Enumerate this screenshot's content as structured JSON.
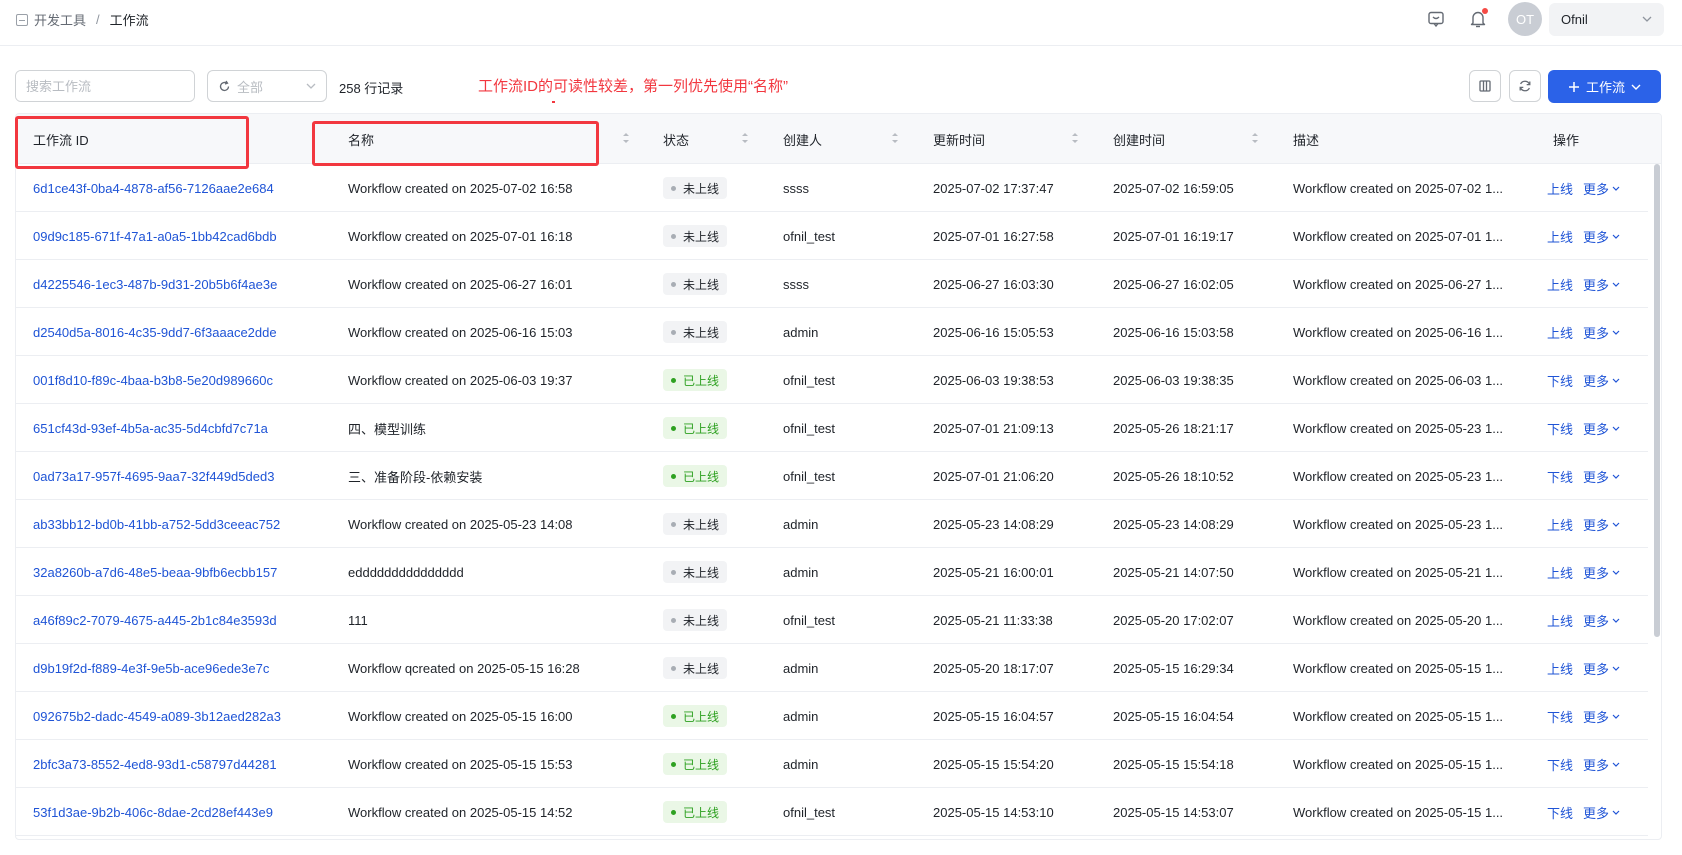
{
  "breadcrumb": {
    "parent": "开发工具",
    "separator": "/",
    "current": "工作流"
  },
  "header": {
    "avatar_initials": "OT",
    "user_name": "Ofnil"
  },
  "toolbar": {
    "search_placeholder": "搜索工作流",
    "filter_value": "全部",
    "record_count": "258 行记录",
    "add_button_label": "工作流"
  },
  "annotation": {
    "text": "工作流ID的可读性较差，第一列优先使用“名称”"
  },
  "table": {
    "columns": {
      "id": "工作流 ID",
      "name": "名称",
      "status": "状态",
      "creator": "创建人",
      "updated": "更新时间",
      "created": "创建时间",
      "desc": "描述",
      "actions": "操作"
    },
    "more_label": "更多",
    "rows": [
      {
        "id": "6d1ce43f-0ba4-4878-af56-7126aae2e684",
        "name": "Workflow created on 2025-07-02 16:58",
        "status": "未上线",
        "online": false,
        "creator": "ssss",
        "updated": "2025-07-02 17:37:47",
        "created": "2025-07-02 16:59:05",
        "desc": "Workflow created on 2025-07-02 1...",
        "action": "上线"
      },
      {
        "id": "09d9c185-671f-47a1-a0a5-1bb42cad6bdb",
        "name": "Workflow created on 2025-07-01 16:18",
        "status": "未上线",
        "online": false,
        "creator": "ofnil_test",
        "updated": "2025-07-01 16:27:58",
        "created": "2025-07-01 16:19:17",
        "desc": "Workflow created on 2025-07-01 1...",
        "action": "上线"
      },
      {
        "id": "d4225546-1ec3-487b-9d31-20b5b6f4ae3e",
        "name": "Workflow created on 2025-06-27 16:01",
        "status": "未上线",
        "online": false,
        "creator": "ssss",
        "updated": "2025-06-27 16:03:30",
        "created": "2025-06-27 16:02:05",
        "desc": "Workflow created on 2025-06-27 1...",
        "action": "上线"
      },
      {
        "id": "d2540d5a-8016-4c35-9dd7-6f3aaace2dde",
        "name": "Workflow created on 2025-06-16 15:03",
        "status": "未上线",
        "online": false,
        "creator": "admin",
        "updated": "2025-06-16 15:05:53",
        "created": "2025-06-16 15:03:58",
        "desc": "Workflow created on 2025-06-16 1...",
        "action": "上线"
      },
      {
        "id": "001f8d10-f89c-4baa-b3b8-5e20d989660c",
        "name": "Workflow created on 2025-06-03 19:37",
        "status": "已上线",
        "online": true,
        "creator": "ofnil_test",
        "updated": "2025-06-03 19:38:53",
        "created": "2025-06-03 19:38:35",
        "desc": "Workflow created on 2025-06-03 1...",
        "action": "下线"
      },
      {
        "id": "651cf43d-93ef-4b5a-ac35-5d4cbfd7c71a",
        "name": "四、模型训练",
        "status": "已上线",
        "online": true,
        "creator": "ofnil_test",
        "updated": "2025-07-01 21:09:13",
        "created": "2025-05-26 18:21:17",
        "desc": "Workflow created on 2025-05-23 1...",
        "action": "下线"
      },
      {
        "id": "0ad73a17-957f-4695-9aa7-32f449d5ded3",
        "name": "三、准备阶段-依赖安装",
        "status": "已上线",
        "online": true,
        "creator": "ofnil_test",
        "updated": "2025-07-01 21:06:20",
        "created": "2025-05-26 18:10:52",
        "desc": "Workflow created on 2025-05-23 1...",
        "action": "下线"
      },
      {
        "id": "ab33bb12-bd0b-41bb-a752-5dd3ceeac752",
        "name": "Workflow created on 2025-05-23 14:08",
        "status": "未上线",
        "online": false,
        "creator": "admin",
        "updated": "2025-05-23 14:08:29",
        "created": "2025-05-23 14:08:29",
        "desc": "Workflow created on 2025-05-23 1...",
        "action": "上线"
      },
      {
        "id": "32a8260b-a7d6-48e5-beaa-9bfb6ecbb157",
        "name": "eddddddddddddddd",
        "status": "未上线",
        "online": false,
        "creator": "admin",
        "updated": "2025-05-21 16:00:01",
        "created": "2025-05-21 14:07:50",
        "desc": "Workflow created on 2025-05-21 1...",
        "action": "上线"
      },
      {
        "id": "a46f89c2-7079-4675-a445-2b1c84e3593d",
        "name": "111",
        "status": "未上线",
        "online": false,
        "creator": "ofnil_test",
        "updated": "2025-05-21 11:33:38",
        "created": "2025-05-20 17:02:07",
        "desc": "Workflow created on 2025-05-20 1...",
        "action": "上线"
      },
      {
        "id": "d9b19f2d-f889-4e3f-9e5b-ace96ede3e7c",
        "name": "Workflow qcreated on 2025-05-15 16:28",
        "status": "未上线",
        "online": false,
        "creator": "admin",
        "updated": "2025-05-20 18:17:07",
        "created": "2025-05-15 16:29:34",
        "desc": "Workflow created on 2025-05-15 1...",
        "action": "上线"
      },
      {
        "id": "092675b2-dadc-4549-a089-3b12aed282a3",
        "name": "Workflow created on 2025-05-15 16:00",
        "status": "已上线",
        "online": true,
        "creator": "admin",
        "updated": "2025-05-15 16:04:57",
        "created": "2025-05-15 16:04:54",
        "desc": "Workflow created on 2025-05-15 1...",
        "action": "下线"
      },
      {
        "id": "2bfc3a73-8552-4ed8-93d1-c58797d44281",
        "name": "Workflow created on 2025-05-15 15:53",
        "status": "已上线",
        "online": true,
        "creator": "admin",
        "updated": "2025-05-15 15:54:20",
        "created": "2025-05-15 15:54:18",
        "desc": "Workflow created on 2025-05-15 1...",
        "action": "下线"
      },
      {
        "id": "53f1d3ae-9b2b-406c-8dae-2cd28ef443e9",
        "name": "Workflow created on 2025-05-15 14:52",
        "status": "已上线",
        "online": true,
        "creator": "ofnil_test",
        "updated": "2025-05-15 14:53:10",
        "created": "2025-05-15 14:53:07",
        "desc": "Workflow created on 2025-05-15 1...",
        "action": "下线"
      }
    ]
  },
  "colors": {
    "accent": "#2b62e8",
    "link": "#1f54d6",
    "online": "#2ea121",
    "annotation": "#f2373f"
  }
}
